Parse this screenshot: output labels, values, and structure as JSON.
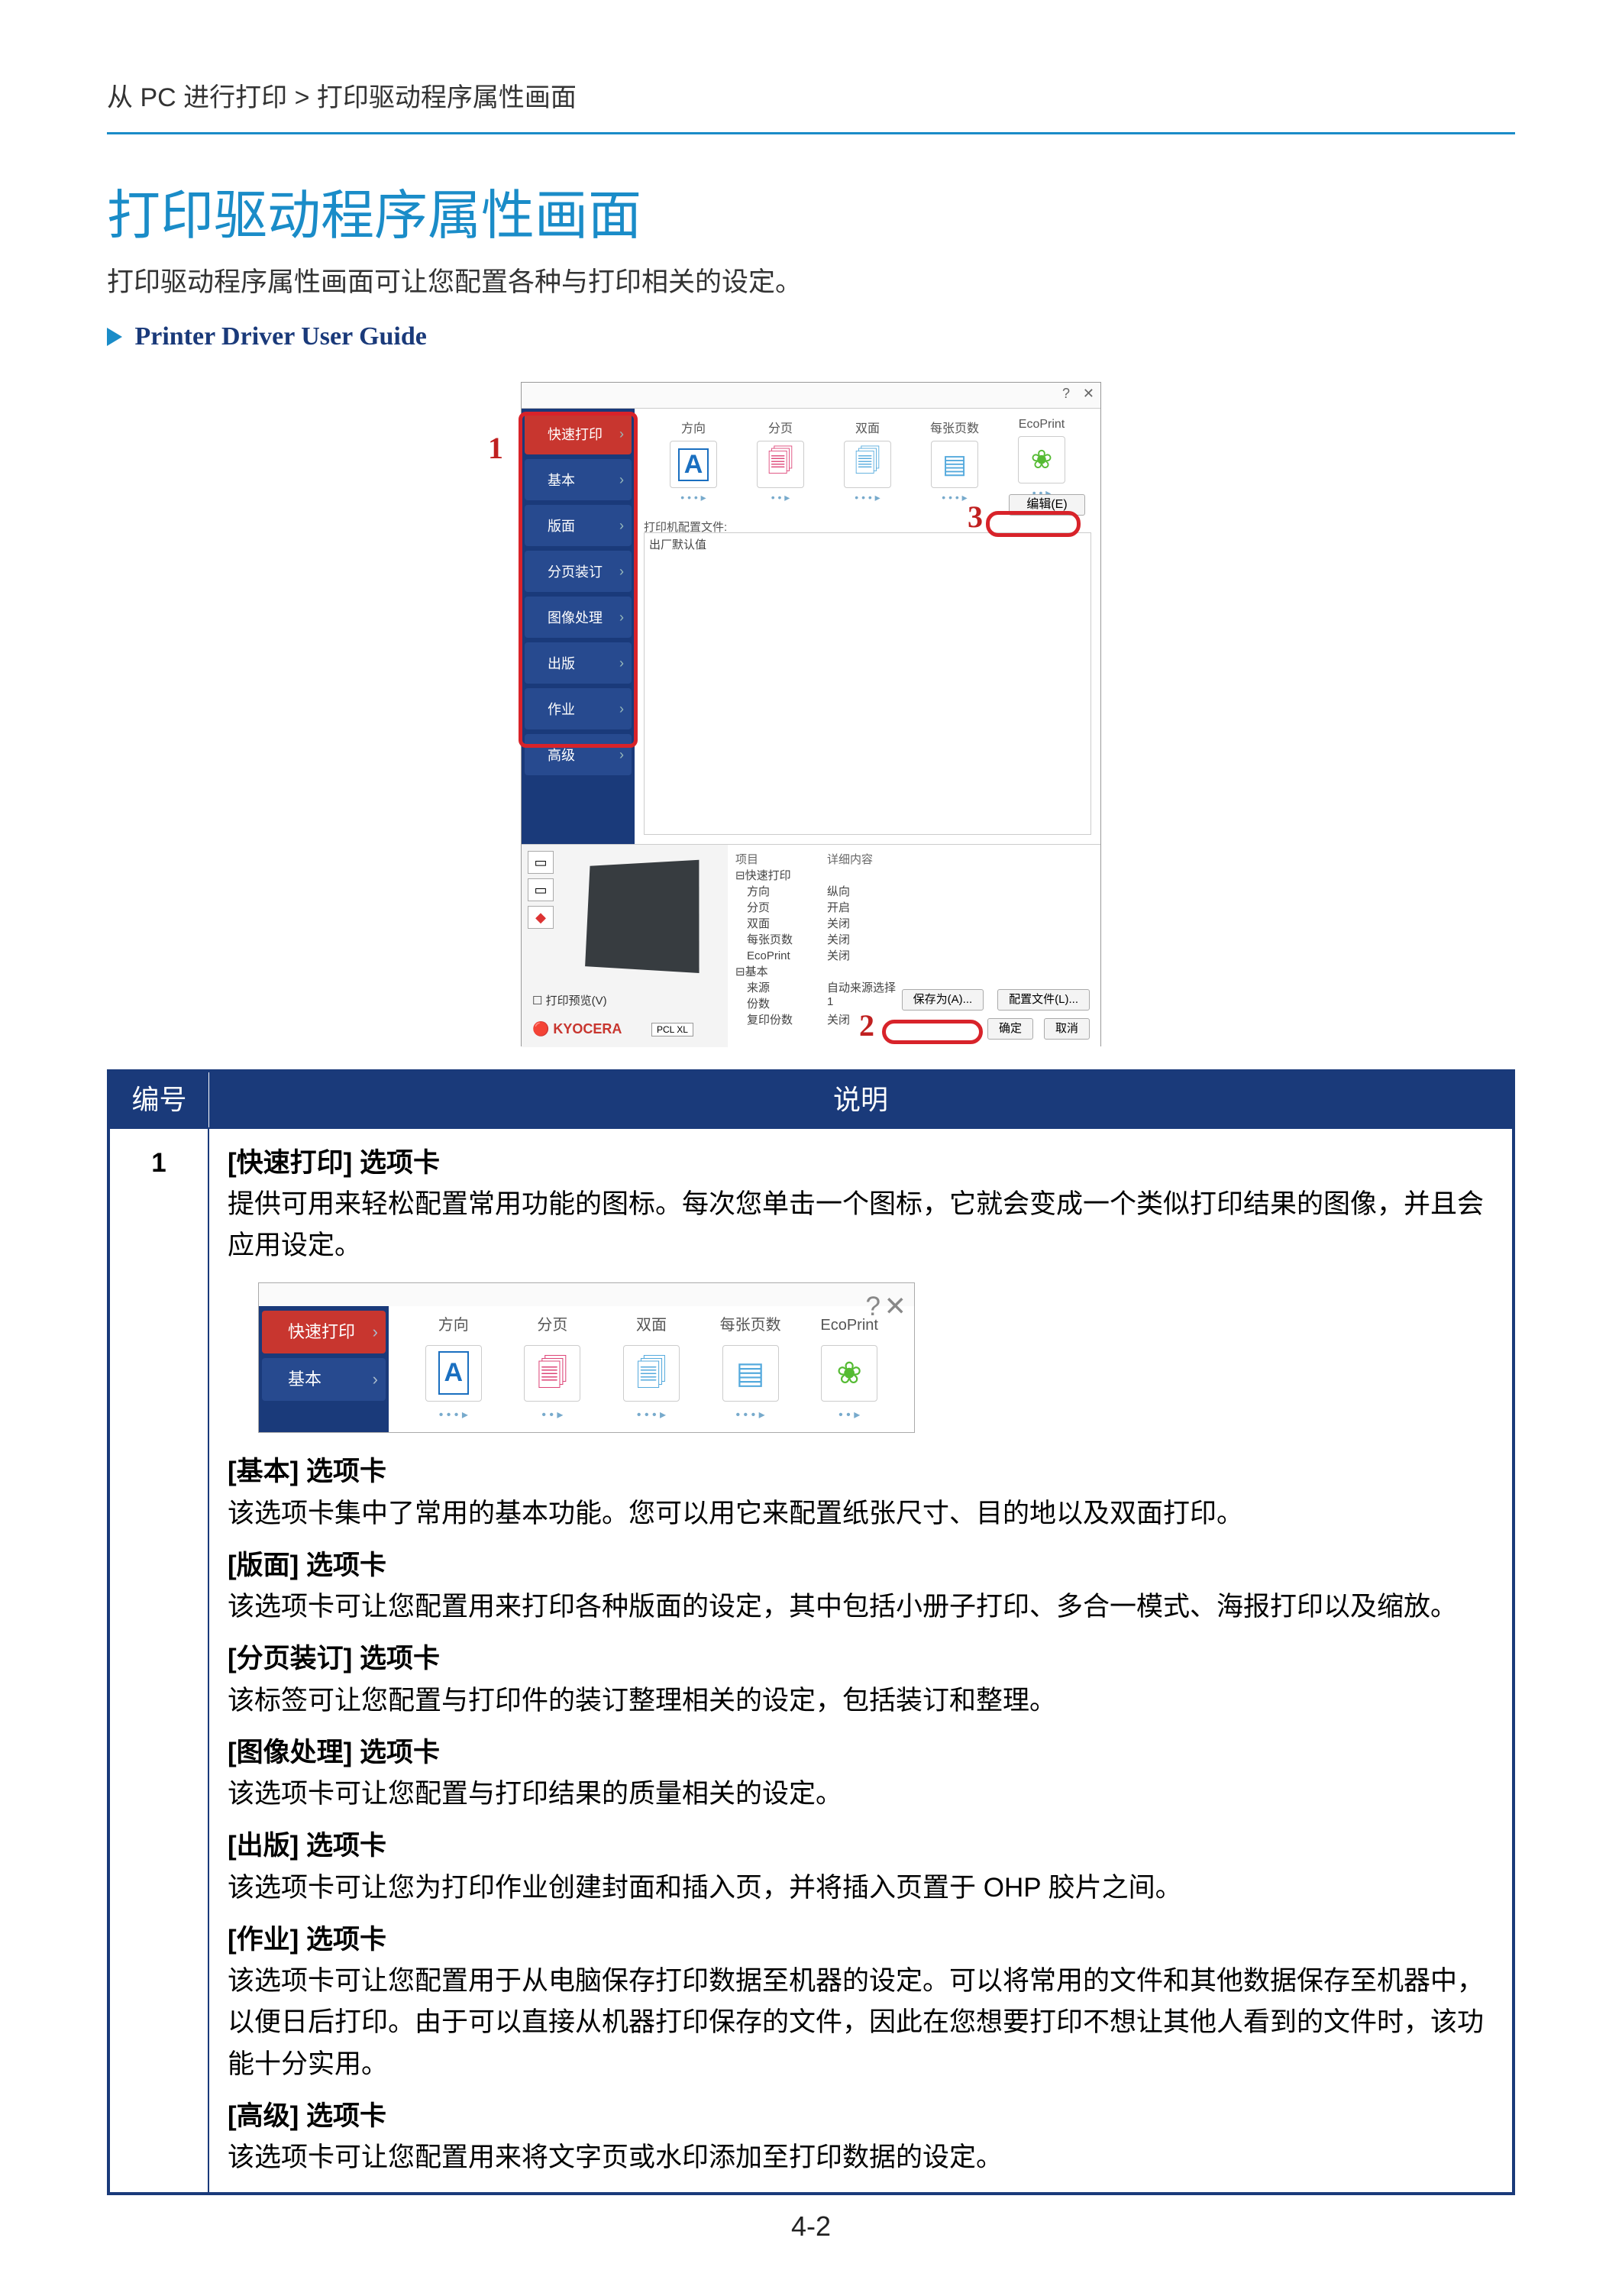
{
  "breadcrumb": "从 PC 进行打印 > 打印驱动程序属性画面",
  "title": "打印驱动程序属性画面",
  "subtitle": "打印驱动程序属性画面可让您配置各种与打印相关的设定。",
  "guide_link": "Printer Driver User Guide",
  "page_number": "4-2",
  "callouts": {
    "one": "1",
    "two": "2",
    "three": "3"
  },
  "shot": {
    "side": [
      "快速打印",
      "基本",
      "版面",
      "分页装订",
      "图像处理",
      "出版",
      "作业",
      "高级"
    ],
    "icons": [
      "方向",
      "分页",
      "双面",
      "每张页数",
      "EcoPrint"
    ],
    "edit_btn": "编辑(E)",
    "cfg_label": "打印机配置文件:",
    "cfg_value": "出厂默认值",
    "props_header": {
      "col1": "项目",
      "col2": "详细内容"
    },
    "props": [
      [
        "⊟快速打印",
        ""
      ],
      [
        "　方向",
        "纵向"
      ],
      [
        "　分页",
        "开启"
      ],
      [
        "　双面",
        "关闭"
      ],
      [
        "　每张页数",
        "关闭"
      ],
      [
        "　EcoPrint",
        "关闭"
      ],
      [
        "⊟基本",
        ""
      ],
      [
        "　来源",
        "自动来源选择"
      ],
      [
        "　份数",
        "1"
      ],
      [
        "　复印份数",
        "关闭"
      ]
    ],
    "chk": "打印预览(V)",
    "save_btn": "保存为(A)...",
    "profile_btn": "配置文件(L)...",
    "brand": "KYOCERA",
    "ok": "确定",
    "cancel": "取消",
    "pcl": "PCL XL"
  },
  "table": {
    "head_num": "编号",
    "head_desc": "说明",
    "row1_num": "1",
    "quick": {
      "title": "[快速打印] 选项卡",
      "body": "提供可用来轻松配置常用功能的图标。每次您单击一个图标，它就会变成一个类似打印结果的图像，并且会应用设定。"
    },
    "basic": {
      "title": "[基本] 选项卡",
      "body": "该选项卡集中了常用的基本功能。您可以用它来配置纸张尺寸、目的地以及双面打印。"
    },
    "layout": {
      "title": "[版面] 选项卡",
      "body": "该选项卡可让您配置用来打印各种版面的设定，其中包括小册子打印、多合一模式、海报打印以及缩放。"
    },
    "finish": {
      "title": "[分页装订] 选项卡",
      "body": "该标签可让您配置与打印件的装订整理相关的设定，包括装订和整理。"
    },
    "image": {
      "title": "[图像处理] 选项卡",
      "body": "该选项卡可让您配置与打印结果的质量相关的设定。"
    },
    "publish": {
      "title": "[出版] 选项卡",
      "body": "该选项卡可让您为打印作业创建封面和插入页，并将插入页置于 OHP 胶片之间。"
    },
    "job": {
      "title": "[作业] 选项卡",
      "body": "该选项卡可让您配置用于从电脑保存打印数据至机器的设定。可以将常用的文件和其他数据保存至机器中，以便日后打印。由于可以直接从机器打印保存的文件，因此在您想要打印不想让其他人看到的文件时，该功能十分实用。"
    },
    "adv": {
      "title": "[高级] 选项卡",
      "body": "该选项卡可让您配置用来将文字页或水印添加至打印数据的设定。"
    }
  }
}
